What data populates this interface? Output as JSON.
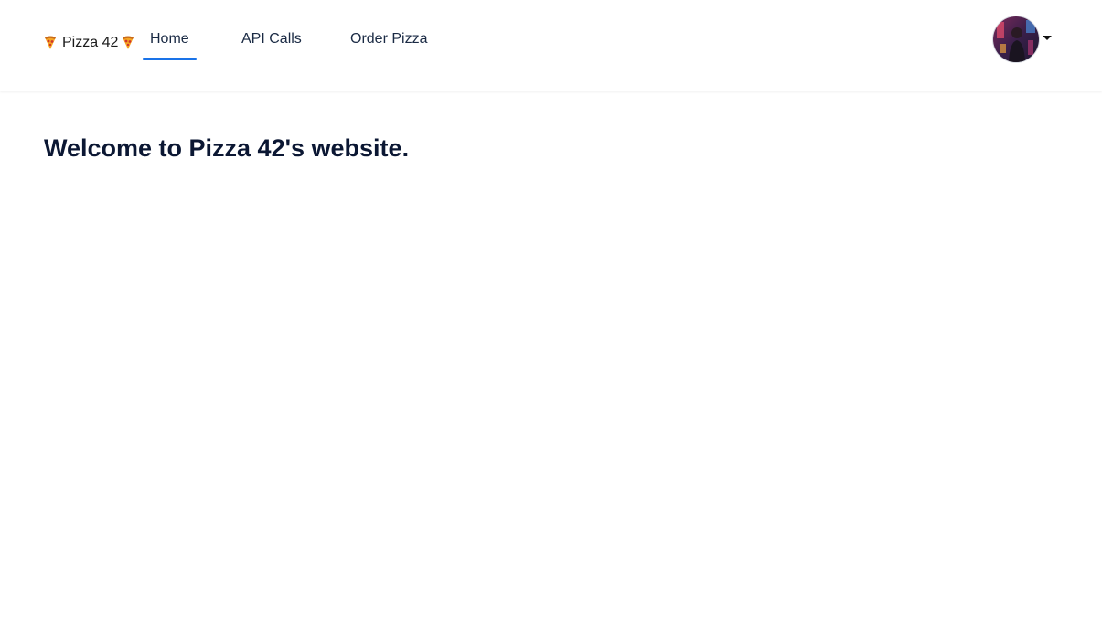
{
  "brand": {
    "text": "Pizza 42",
    "icon": "pizza-slice"
  },
  "nav": {
    "items": [
      {
        "label": "Home",
        "active": true
      },
      {
        "label": "API Calls",
        "active": false
      },
      {
        "label": "Order Pizza",
        "active": false
      }
    ]
  },
  "user": {
    "menu_icon": "caret-down"
  },
  "main": {
    "heading": "Welcome to Pizza 42's website."
  },
  "colors": {
    "accent": "#1a73e8",
    "heading": "#0b1733"
  }
}
